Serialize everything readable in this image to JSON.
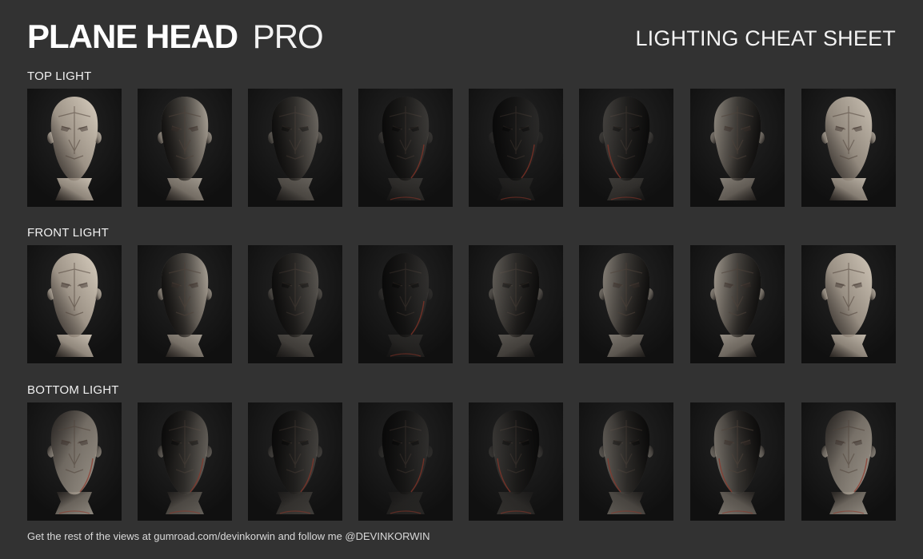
{
  "header": {
    "brand_bold": "PLANE HEAD",
    "brand_light": "PRO",
    "sheet_title": "LIGHTING CHEAT SHEET"
  },
  "sections": [
    {
      "key": "top",
      "label": "TOP LIGHT",
      "light_direction": "top",
      "variations": [
        {
          "light": "front",
          "intensity": 1.0,
          "side": "both"
        },
        {
          "light": "three-quarter",
          "intensity": 0.78,
          "side": "right"
        },
        {
          "light": "side",
          "intensity": 0.45,
          "side": "right"
        },
        {
          "light": "rim",
          "intensity": 0.18,
          "side": "right"
        },
        {
          "light": "back",
          "intensity": 0.08,
          "side": "both"
        },
        {
          "light": "rim",
          "intensity": 0.22,
          "side": "left"
        },
        {
          "light": "three-quarter",
          "intensity": 0.62,
          "side": "left"
        },
        {
          "light": "front",
          "intensity": 0.92,
          "side": "both"
        }
      ]
    },
    {
      "key": "front",
      "label": "FRONT LIGHT",
      "light_direction": "front",
      "variations": [
        {
          "light": "front",
          "intensity": 1.0,
          "side": "both"
        },
        {
          "light": "three-quarter",
          "intensity": 0.78,
          "side": "right"
        },
        {
          "light": "side",
          "intensity": 0.35,
          "side": "right"
        },
        {
          "light": "rim",
          "intensity": 0.12,
          "side": "right"
        },
        {
          "light": "side",
          "intensity": 0.38,
          "side": "left"
        },
        {
          "light": "side",
          "intensity": 0.58,
          "side": "left"
        },
        {
          "light": "three-quarter",
          "intensity": 0.72,
          "side": "left"
        },
        {
          "light": "front",
          "intensity": 0.96,
          "side": "both"
        }
      ]
    },
    {
      "key": "bottom",
      "label": "BOTTOM LIGHT",
      "light_direction": "bottom",
      "variations": [
        {
          "light": "front",
          "intensity": 0.68,
          "side": "both"
        },
        {
          "light": "three-quarter",
          "intensity": 0.45,
          "side": "right"
        },
        {
          "light": "side",
          "intensity": 0.25,
          "side": "right"
        },
        {
          "light": "rim",
          "intensity": 0.12,
          "side": "right"
        },
        {
          "light": "rim",
          "intensity": 0.18,
          "side": "left"
        },
        {
          "light": "three-quarter",
          "intensity": 0.42,
          "side": "left"
        },
        {
          "light": "three-quarter",
          "intensity": 0.56,
          "side": "left"
        },
        {
          "light": "front",
          "intensity": 0.7,
          "side": "both"
        }
      ]
    }
  ],
  "footer": {
    "text": "Get the rest of the views at gumroad.com/devinkorwin and follow me @DEVINKORWIN"
  },
  "colors": {
    "background": "#323232",
    "tile": "#171717",
    "head": "#d9cfc0",
    "head_shadow": "#4b4038",
    "rim": "#8f3528"
  }
}
